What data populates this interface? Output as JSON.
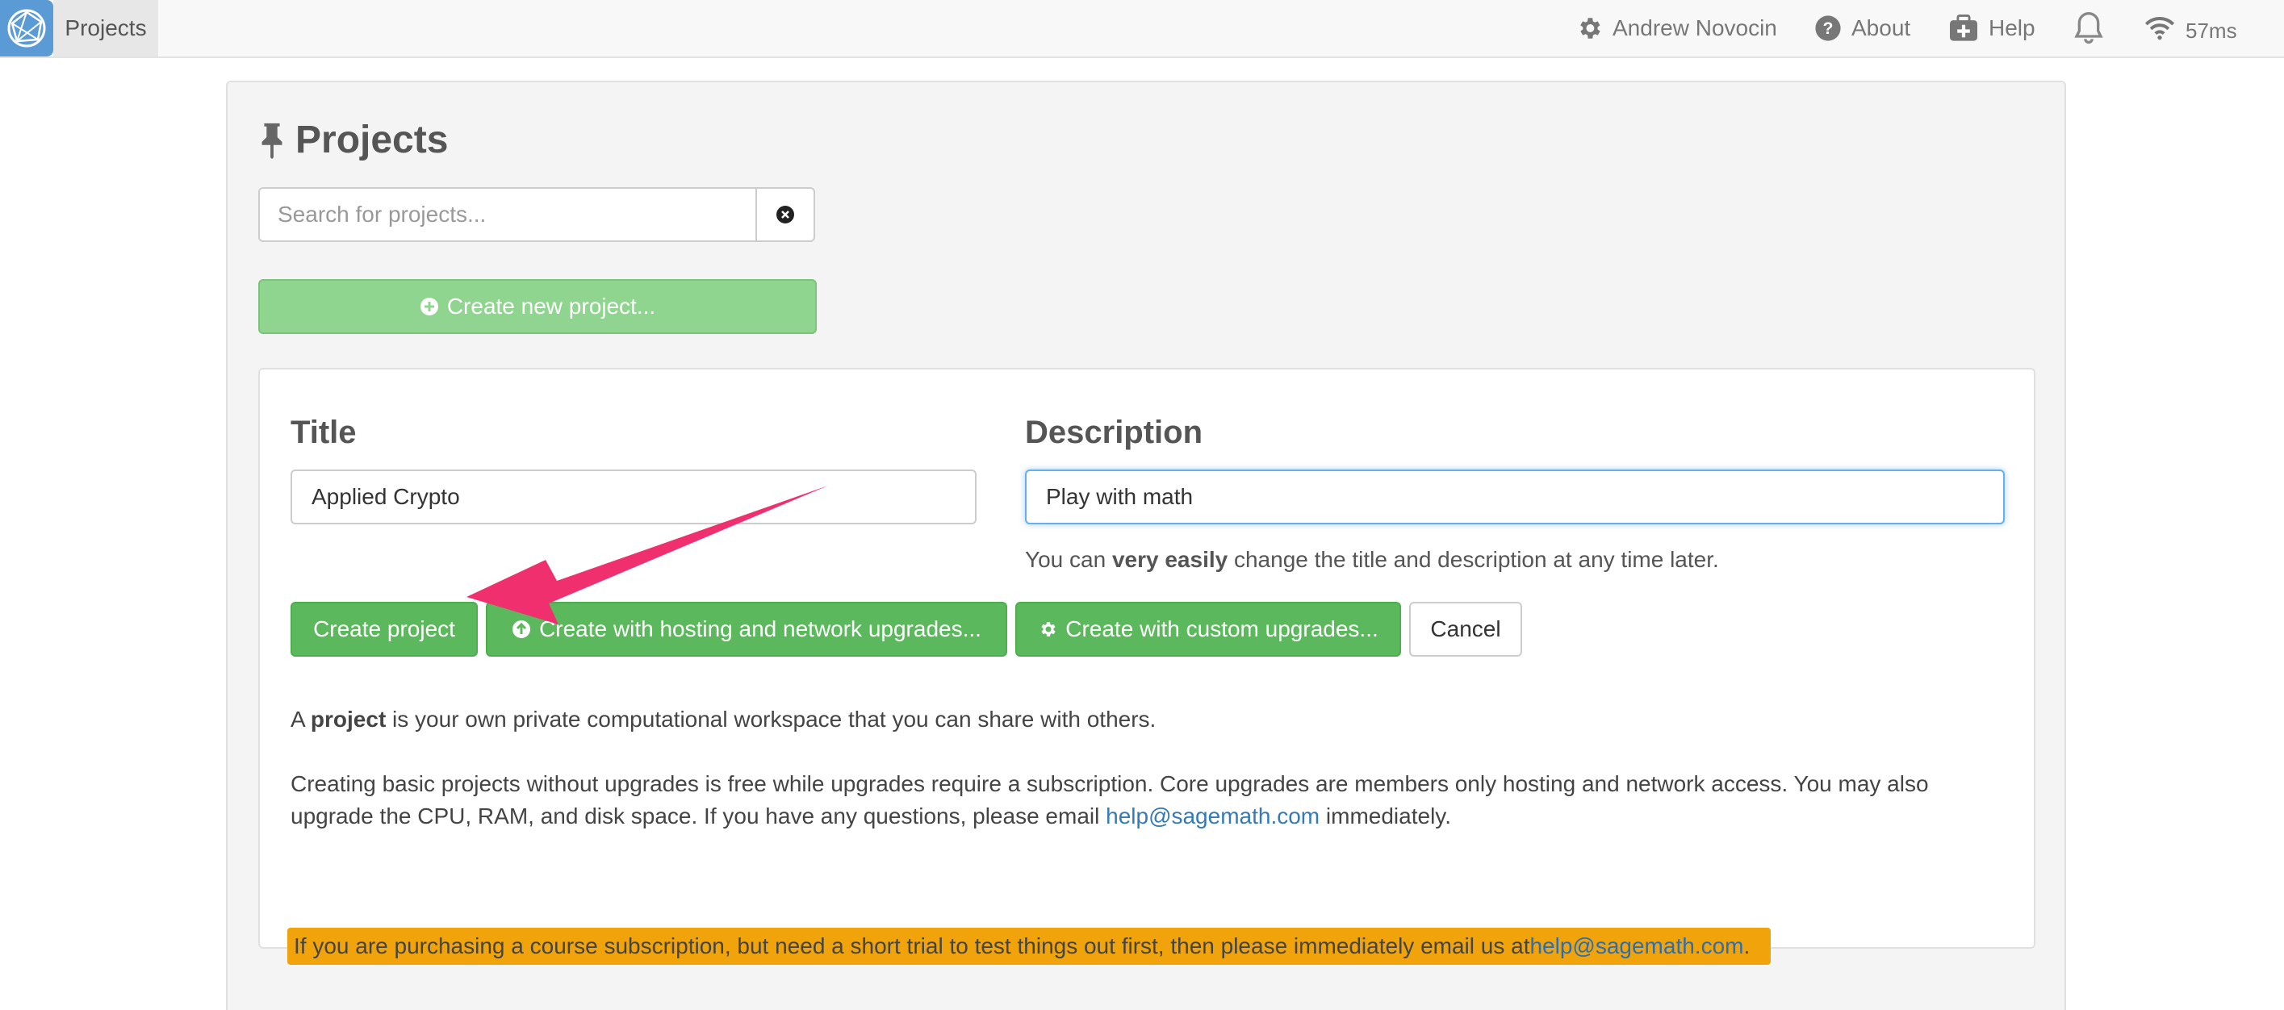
{
  "nav": {
    "tab_label": "Projects",
    "user_name": "Andrew Novocin",
    "about_label": "About",
    "help_label": "Help",
    "ping": "57ms"
  },
  "page": {
    "title": "Projects",
    "search_placeholder": "Search for projects...",
    "create_new_label": "Create new project..."
  },
  "form": {
    "title_label": "Title",
    "title_value": "Applied Crypto",
    "description_label": "Description",
    "description_value": "Play with math",
    "hint_prefix": "You can ",
    "hint_bold": "very easily",
    "hint_suffix": " change the title and description at any time later.",
    "buttons": {
      "create": "Create project",
      "create_hosting": "Create with hosting and network upgrades...",
      "create_custom": "Create with custom upgrades...",
      "cancel": "Cancel"
    }
  },
  "info": {
    "p1_prefix": "A ",
    "p1_bold": "project",
    "p1_suffix": " is your own private computational workspace that you can share with others.",
    "p2_text": "Creating basic projects without upgrades is free while upgrades require a subscription. Core upgrades are members only hosting and network access. You may also upgrade the CPU, RAM, and disk space. If you have any questions, please email ",
    "p2_link": "help@sagemath.com",
    "p2_suffix": " immediately.",
    "warning_text": "If you are purchasing a course subscription, but need a short trial to test things out first, then please immediately email us at ",
    "warning_link": "help@sagemath.com",
    "warning_suffix": "."
  },
  "colors": {
    "primary_green": "#5cb85c",
    "light_green": "#8fd48f",
    "warning_orange": "#f0a30a",
    "link_blue": "#337ab7",
    "arrow_pink": "#f0306e"
  }
}
